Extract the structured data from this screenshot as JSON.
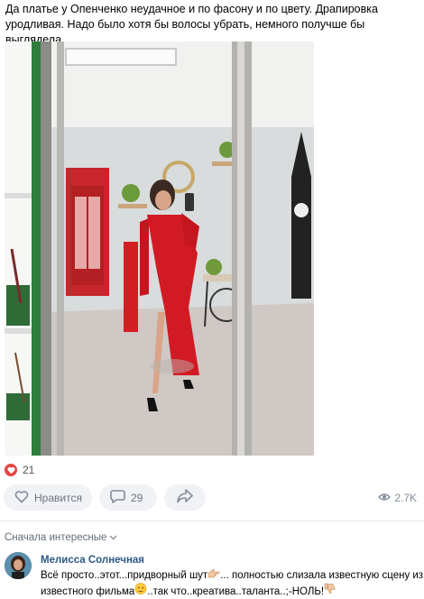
{
  "post": {
    "text": "Да платье у Опенченко неудачное и по фасону и по цвету. Драпировка уродливая. Надо было хотя бы волосы убрать, немного получше бы выглядела"
  },
  "reactions": {
    "count": "21",
    "icon": "heart-icon"
  },
  "actions": {
    "like_label": "Нравится",
    "comments_count": "29",
    "share_icon": "share-icon"
  },
  "views": {
    "count": "2.7K",
    "icon": "eye-icon"
  },
  "comments": {
    "sort_label": "Сначала интересные",
    "items": [
      {
        "author": "Мелисса Солнечная",
        "text_part1": "Всё просто..этот...придворный шут",
        "text_part2": "... полностью слизала известную сцену из известного фильма",
        "text_part3": "..так что..креатива..таланта..;-НОЛЬ!"
      }
    ]
  },
  "colors": {
    "accent": "#2a5885",
    "dress": "#d21a24",
    "heart": "#e64646",
    "pill_bg": "#f0f2f5"
  }
}
